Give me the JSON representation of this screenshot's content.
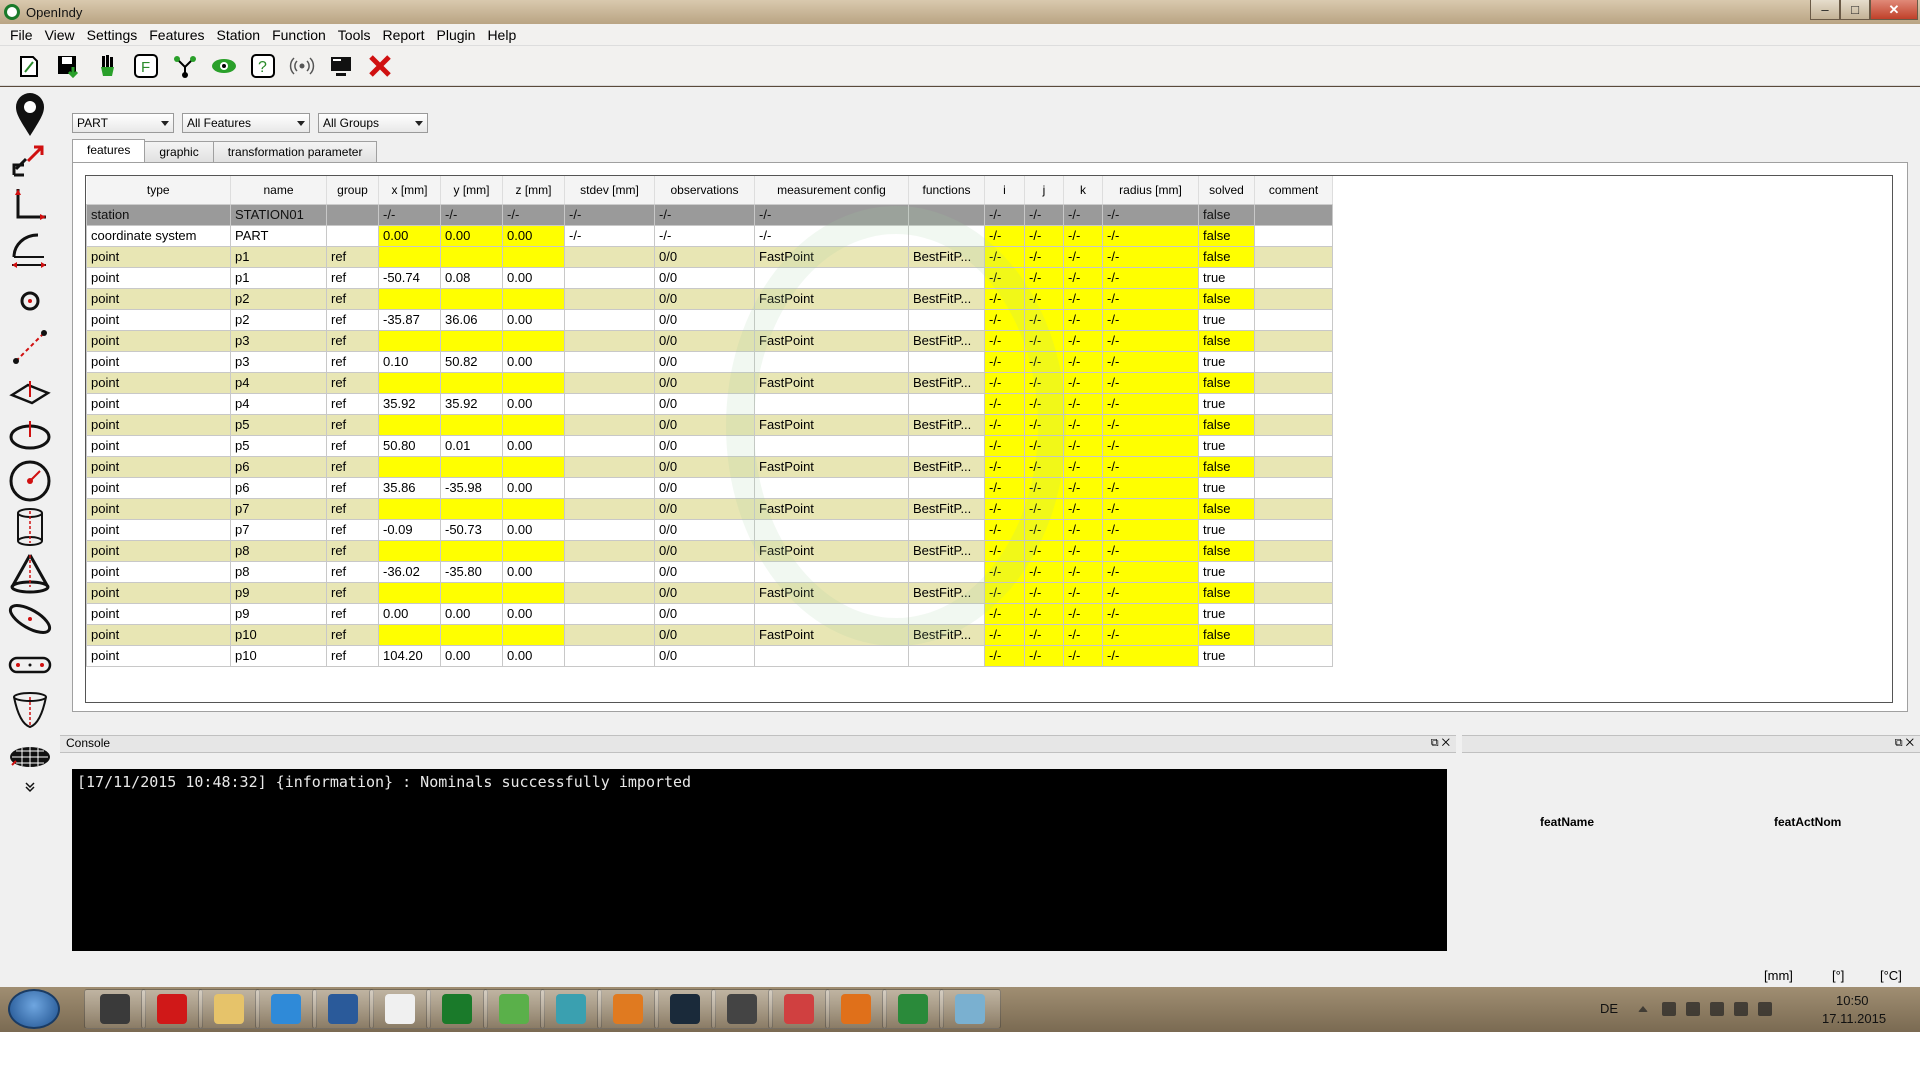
{
  "window": {
    "title": "OpenIndy",
    "minimize": "–",
    "maximize": "□",
    "close": "✕"
  },
  "menu": [
    "File",
    "View",
    "Settings",
    "Features",
    "Station",
    "Function",
    "Tools",
    "Report",
    "Plugin",
    "Help"
  ],
  "toolbar_icons": [
    "new-project-icon",
    "save-icon",
    "hand-icon",
    "feature-icon",
    "network-icon",
    "eye-icon",
    "help-icon",
    "radio-icon",
    "monitor-icon",
    "delete-icon"
  ],
  "left_tools": [
    "point-icon",
    "transform-icon",
    "coordinate-system-icon",
    "arc-icon",
    "target-icon",
    "line-icon",
    "plane-icon",
    "circle-icon",
    "sphere-icon",
    "cylinder-icon",
    "cone-icon",
    "ellipse-icon",
    "slotted-hole-icon",
    "paraboloid-icon",
    "surface-icon",
    "more-icon"
  ],
  "filters": {
    "system": "PART",
    "features": "All Features",
    "groups": "All Groups"
  },
  "tabs": [
    "features",
    "graphic",
    "transformation parameter"
  ],
  "table": {
    "columns": [
      "type",
      "name",
      "group",
      "x [mm]",
      "y [mm]",
      "z [mm]",
      "stdev [mm]",
      "observations",
      "measurement config",
      "functions",
      "i",
      "j",
      "k",
      "radius [mm]",
      "solved",
      "comment"
    ],
    "rows": [
      [
        "station",
        "STATION01",
        "",
        "-/-",
        "-/-",
        "-/-",
        "-/-",
        "-/-",
        "-/-",
        "",
        "-/-",
        "-/-",
        "-/-",
        "-/-",
        "false",
        ""
      ],
      [
        "coordinate system",
        "PART",
        "",
        "0.00",
        "0.00",
        "0.00",
        "-/-",
        "-/-",
        "-/-",
        "",
        "-/-",
        "-/-",
        "-/-",
        "-/-",
        "false",
        ""
      ],
      [
        "point",
        "p1",
        "ref",
        "",
        "",
        "",
        "",
        "0/0",
        "FastPoint",
        "BestFitP...",
        "-/-",
        "-/-",
        "-/-",
        "-/-",
        "false",
        ""
      ],
      [
        "point",
        "p1",
        "ref",
        "-50.74",
        "0.08",
        "0.00",
        "",
        "0/0",
        "",
        "",
        "-/-",
        "-/-",
        "-/-",
        "-/-",
        "true",
        ""
      ],
      [
        "point",
        "p2",
        "ref",
        "",
        "",
        "",
        "",
        "0/0",
        "FastPoint",
        "BestFitP...",
        "-/-",
        "-/-",
        "-/-",
        "-/-",
        "false",
        ""
      ],
      [
        "point",
        "p2",
        "ref",
        "-35.87",
        "36.06",
        "0.00",
        "",
        "0/0",
        "",
        "",
        "-/-",
        "-/-",
        "-/-",
        "-/-",
        "true",
        ""
      ],
      [
        "point",
        "p3",
        "ref",
        "",
        "",
        "",
        "",
        "0/0",
        "FastPoint",
        "BestFitP...",
        "-/-",
        "-/-",
        "-/-",
        "-/-",
        "false",
        ""
      ],
      [
        "point",
        "p3",
        "ref",
        "0.10",
        "50.82",
        "0.00",
        "",
        "0/0",
        "",
        "",
        "-/-",
        "-/-",
        "-/-",
        "-/-",
        "true",
        ""
      ],
      [
        "point",
        "p4",
        "ref",
        "",
        "",
        "",
        "",
        "0/0",
        "FastPoint",
        "BestFitP...",
        "-/-",
        "-/-",
        "-/-",
        "-/-",
        "false",
        ""
      ],
      [
        "point",
        "p4",
        "ref",
        "35.92",
        "35.92",
        "0.00",
        "",
        "0/0",
        "",
        "",
        "-/-",
        "-/-",
        "-/-",
        "-/-",
        "true",
        ""
      ],
      [
        "point",
        "p5",
        "ref",
        "",
        "",
        "",
        "",
        "0/0",
        "FastPoint",
        "BestFitP...",
        "-/-",
        "-/-",
        "-/-",
        "-/-",
        "false",
        ""
      ],
      [
        "point",
        "p5",
        "ref",
        "50.80",
        "0.01",
        "0.00",
        "",
        "0/0",
        "",
        "",
        "-/-",
        "-/-",
        "-/-",
        "-/-",
        "true",
        ""
      ],
      [
        "point",
        "p6",
        "ref",
        "",
        "",
        "",
        "",
        "0/0",
        "FastPoint",
        "BestFitP...",
        "-/-",
        "-/-",
        "-/-",
        "-/-",
        "false",
        ""
      ],
      [
        "point",
        "p6",
        "ref",
        "35.86",
        "-35.98",
        "0.00",
        "",
        "0/0",
        "",
        "",
        "-/-",
        "-/-",
        "-/-",
        "-/-",
        "true",
        ""
      ],
      [
        "point",
        "p7",
        "ref",
        "",
        "",
        "",
        "",
        "0/0",
        "FastPoint",
        "BestFitP...",
        "-/-",
        "-/-",
        "-/-",
        "-/-",
        "false",
        ""
      ],
      [
        "point",
        "p7",
        "ref",
        "-0.09",
        "-50.73",
        "0.00",
        "",
        "0/0",
        "",
        "",
        "-/-",
        "-/-",
        "-/-",
        "-/-",
        "true",
        ""
      ],
      [
        "point",
        "p8",
        "ref",
        "",
        "",
        "",
        "",
        "0/0",
        "FastPoint",
        "BestFitP...",
        "-/-",
        "-/-",
        "-/-",
        "-/-",
        "false",
        ""
      ],
      [
        "point",
        "p8",
        "ref",
        "-36.02",
        "-35.80",
        "0.00",
        "",
        "0/0",
        "",
        "",
        "-/-",
        "-/-",
        "-/-",
        "-/-",
        "true",
        ""
      ],
      [
        "point",
        "p9",
        "ref",
        "",
        "",
        "",
        "",
        "0/0",
        "FastPoint",
        "BestFitP...",
        "-/-",
        "-/-",
        "-/-",
        "-/-",
        "false",
        ""
      ],
      [
        "point",
        "p9",
        "ref",
        "0.00",
        "0.00",
        "0.00",
        "",
        "0/0",
        "",
        "",
        "-/-",
        "-/-",
        "-/-",
        "-/-",
        "true",
        ""
      ],
      [
        "point",
        "p10",
        "ref",
        "",
        "",
        "",
        "",
        "0/0",
        "FastPoint",
        "BestFitP...",
        "-/-",
        "-/-",
        "-/-",
        "-/-",
        "false",
        ""
      ],
      [
        "point",
        "p10",
        "ref",
        "104.20",
        "0.00",
        "0.00",
        "",
        "0/0",
        "",
        "",
        "-/-",
        "-/-",
        "-/-",
        "-/-",
        "true",
        ""
      ]
    ]
  },
  "console": {
    "title": "Console",
    "line": "[17/11/2015 10:48:32] {information} : Nominals successfully imported"
  },
  "right_panel": {
    "col1": "featName",
    "col2": "featActNom"
  },
  "status": {
    "length_unit": "[mm]",
    "angle_unit": "[°]",
    "temp_unit": "[°C]"
  },
  "taskbar": {
    "apps": [
      "files-app",
      "globe-app",
      "explorer-app",
      "chrome-app",
      "thunderbird-app",
      "calendar-app",
      "openindy-app",
      "qt-app",
      "network-app",
      "pdf-reader-app",
      "steam-app",
      "sublime-app",
      "pdf-app",
      "firefox-app",
      "excel-app",
      "paint-app"
    ],
    "lang": "DE",
    "time": "10:50",
    "date": "17.11.2015"
  },
  "colors": {
    "yellow": "#ffff00",
    "even_row": "#e8e6b4",
    "station_row": "#9a9a9a"
  }
}
